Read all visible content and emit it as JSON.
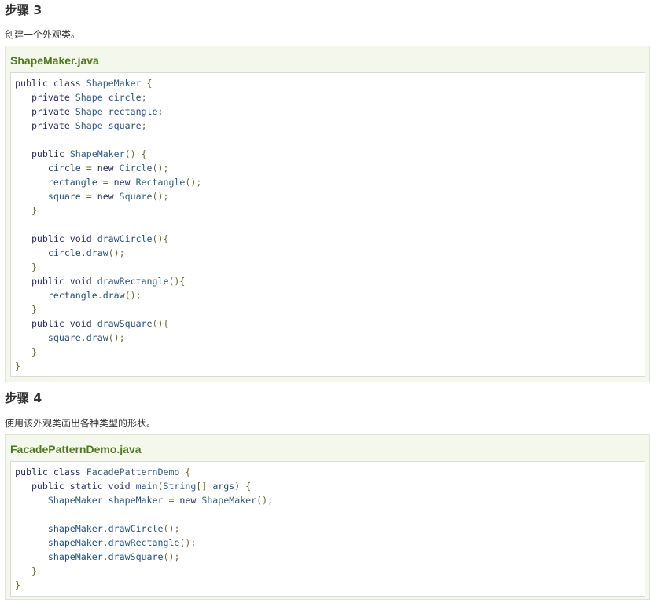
{
  "step3": {
    "heading": "步骤 3",
    "description": "创建一个外观类。",
    "filename": "ShapeMaker.java",
    "code": [
      [
        [
          "kw",
          "public class "
        ],
        [
          "ty",
          "ShapeMaker "
        ],
        [
          "pn",
          "{"
        ]
      ],
      [
        [
          "kw",
          "   private "
        ],
        [
          "ty",
          "Shape "
        ],
        [
          "id",
          "circle"
        ],
        [
          "pn",
          ";"
        ]
      ],
      [
        [
          "kw",
          "   private "
        ],
        [
          "ty",
          "Shape "
        ],
        [
          "id",
          "rectangle"
        ],
        [
          "pn",
          ";"
        ]
      ],
      [
        [
          "kw",
          "   private "
        ],
        [
          "ty",
          "Shape "
        ],
        [
          "id",
          "square"
        ],
        [
          "pn",
          ";"
        ]
      ],
      [],
      [
        [
          "kw",
          "   public "
        ],
        [
          "ty",
          "ShapeMaker"
        ],
        [
          "pn",
          "() {"
        ]
      ],
      [
        [
          "id",
          "      circle "
        ],
        [
          "pn",
          "= "
        ],
        [
          "kw",
          "new "
        ],
        [
          "ty",
          "Circle"
        ],
        [
          "pn",
          "();"
        ]
      ],
      [
        [
          "id",
          "      rectangle "
        ],
        [
          "pn",
          "= "
        ],
        [
          "kw",
          "new "
        ],
        [
          "ty",
          "Rectangle"
        ],
        [
          "pn",
          "();"
        ]
      ],
      [
        [
          "id",
          "      square "
        ],
        [
          "pn",
          "= "
        ],
        [
          "kw",
          "new "
        ],
        [
          "ty",
          "Square"
        ],
        [
          "pn",
          "();"
        ]
      ],
      [
        [
          "pn",
          "   }"
        ]
      ],
      [],
      [
        [
          "kw",
          "   public void "
        ],
        [
          "id",
          "drawCircle"
        ],
        [
          "pn",
          "(){"
        ]
      ],
      [
        [
          "id",
          "      circle"
        ],
        [
          "pn",
          "."
        ],
        [
          "id",
          "draw"
        ],
        [
          "pn",
          "();"
        ]
      ],
      [
        [
          "pn",
          "   }"
        ]
      ],
      [
        [
          "kw",
          "   public void "
        ],
        [
          "id",
          "drawRectangle"
        ],
        [
          "pn",
          "(){"
        ]
      ],
      [
        [
          "id",
          "      rectangle"
        ],
        [
          "pn",
          "."
        ],
        [
          "id",
          "draw"
        ],
        [
          "pn",
          "();"
        ]
      ],
      [
        [
          "pn",
          "   }"
        ]
      ],
      [
        [
          "kw",
          "   public void "
        ],
        [
          "id",
          "drawSquare"
        ],
        [
          "pn",
          "(){"
        ]
      ],
      [
        [
          "id",
          "      square"
        ],
        [
          "pn",
          "."
        ],
        [
          "id",
          "draw"
        ],
        [
          "pn",
          "();"
        ]
      ],
      [
        [
          "pn",
          "   }"
        ]
      ],
      [
        [
          "pn",
          "}"
        ]
      ]
    ]
  },
  "step4": {
    "heading": "步骤 4",
    "description": "使用该外观类画出各种类型的形状。",
    "filename": "FacadePatternDemo.java",
    "code": [
      [
        [
          "kw",
          "public class "
        ],
        [
          "ty",
          "FacadePatternDemo "
        ],
        [
          "pn",
          "{"
        ]
      ],
      [
        [
          "kw",
          "   public static void "
        ],
        [
          "id",
          "main"
        ],
        [
          "pn",
          "("
        ],
        [
          "ty",
          "String"
        ],
        [
          "pn",
          "[] "
        ],
        [
          "id",
          "args"
        ],
        [
          "pn",
          ") {"
        ]
      ],
      [
        [
          "ty",
          "      ShapeMaker "
        ],
        [
          "id",
          "shapeMaker "
        ],
        [
          "pn",
          "= "
        ],
        [
          "kw",
          "new "
        ],
        [
          "ty",
          "ShapeMaker"
        ],
        [
          "pn",
          "();"
        ]
      ],
      [],
      [
        [
          "id",
          "      shapeMaker"
        ],
        [
          "pn",
          "."
        ],
        [
          "id",
          "drawCircle"
        ],
        [
          "pn",
          "();"
        ]
      ],
      [
        [
          "id",
          "      shapeMaker"
        ],
        [
          "pn",
          "."
        ],
        [
          "id",
          "drawRectangle"
        ],
        [
          "pn",
          "();"
        ]
      ],
      [
        [
          "id",
          "      shapeMaker"
        ],
        [
          "pn",
          "."
        ],
        [
          "id",
          "drawSquare"
        ],
        [
          "pn",
          "();"
        ]
      ],
      [
        [
          "pn",
          "   }"
        ]
      ],
      [
        [
          "pn",
          "}"
        ]
      ]
    ]
  }
}
